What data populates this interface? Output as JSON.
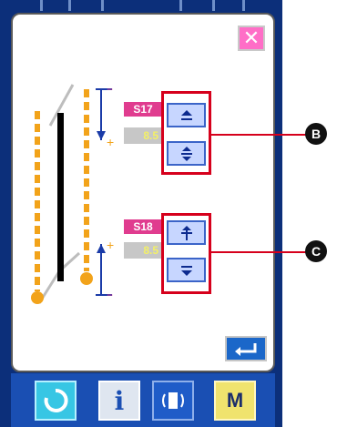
{
  "dialog": {
    "close_icon": "close-icon",
    "sections": [
      {
        "tag": "S17",
        "value": "8.5",
        "buttons": [
          {
            "icon": "decrease-up-icon"
          },
          {
            "icon": "adjust-plus-minus-icon"
          }
        ],
        "callout": "B"
      },
      {
        "tag": "S18",
        "value": "8.5",
        "buttons": [
          {
            "icon": "increase-icon"
          },
          {
            "icon": "decrease-down-icon"
          }
        ],
        "callout": "C"
      }
    ],
    "enter_icon": "enter-icon"
  },
  "bottom_bar": {
    "buttons": [
      {
        "icon": "reset-circle-icon"
      },
      {
        "label": "i",
        "icon": "info-icon"
      },
      {
        "icon": "communication-icon"
      },
      {
        "label": "M",
        "icon": "mode-icon"
      }
    ]
  },
  "colors": {
    "accent_red": "#d6001c",
    "tag_pink": "#e03c8f",
    "button_blue": "#c7d6ff",
    "frame_navy": "#0c2f7a",
    "value_yellow": "#f3f066",
    "guide_orange": "#f2a31a"
  }
}
